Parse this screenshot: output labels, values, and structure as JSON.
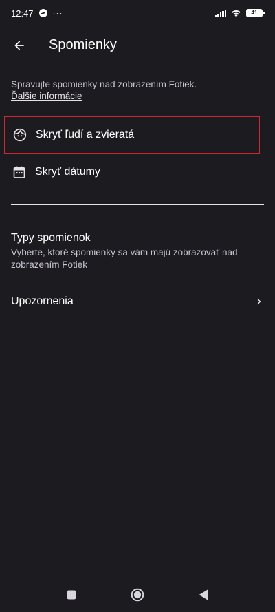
{
  "status_bar": {
    "time": "12:47",
    "more": "···",
    "battery": "41"
  },
  "app_bar": {
    "title": "Spomienky",
    "back_icon": "arrow-back-icon"
  },
  "intro": {
    "description": "Spravujte spomienky nad zobrazením Fotiek.",
    "learn_more": "Ďalšie informácie"
  },
  "options": [
    {
      "label": "Skryť ľudí a zvieratá",
      "icon": "face-icon"
    },
    {
      "label": "Skryť dátumy",
      "icon": "calendar-icon"
    }
  ],
  "memory_types": {
    "title": "Typy spomienok",
    "subtitle": "Vyberte, ktoré spomienky sa vám majú zobrazovať nad zobrazením Fotiek"
  },
  "notifications": {
    "label": "Upozornenia",
    "icon": "chevron-right-icon"
  },
  "colors": {
    "background": "#1c1b20",
    "highlight_border": "#d0262e",
    "text_primary": "#ffffff",
    "text_secondary": "#cac4d0"
  }
}
